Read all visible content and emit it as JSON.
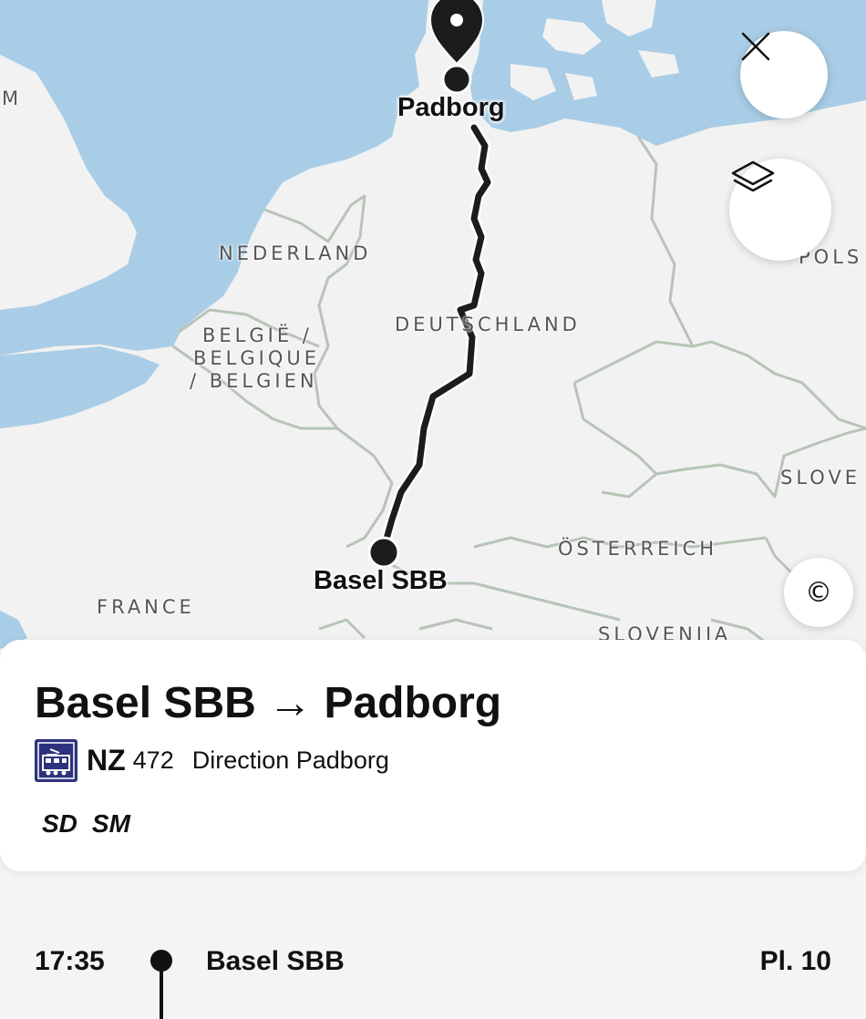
{
  "map": {
    "country_labels": {
      "nederland": "NEDERLAND",
      "belgie_1": "BELGIË /",
      "belgie_2": "BELGIQUE",
      "belgie_3": "/ BELGIEN",
      "deutschland": "DEUTSCHLAND",
      "france": "FRANCE",
      "osterreich": "ÖSTERREICH",
      "slovenija": "SLOVENIJA",
      "slove": "SLOVE",
      "pols": "POLS",
      "m": "M"
    },
    "stations": {
      "origin": "Basel SBB",
      "destination": "Padborg"
    },
    "colors": {
      "water": "#a9cde6",
      "land": "#f2f2f2",
      "border": "#b7c4b7",
      "route": "#1c1c1c"
    }
  },
  "buttons": {
    "close_icon": "close-icon",
    "layers_icon": "layers-icon",
    "copyright_label": "©"
  },
  "trip": {
    "title": "Basel SBB → Padborg",
    "train_icon": "train-icon",
    "category": "NZ",
    "number": "472",
    "direction": "Direction Padborg",
    "attributes": [
      "SD",
      "SM"
    ]
  },
  "stops": [
    {
      "time": "17:35",
      "name": "Basel SBB",
      "platform": "Pl. 10"
    }
  ]
}
